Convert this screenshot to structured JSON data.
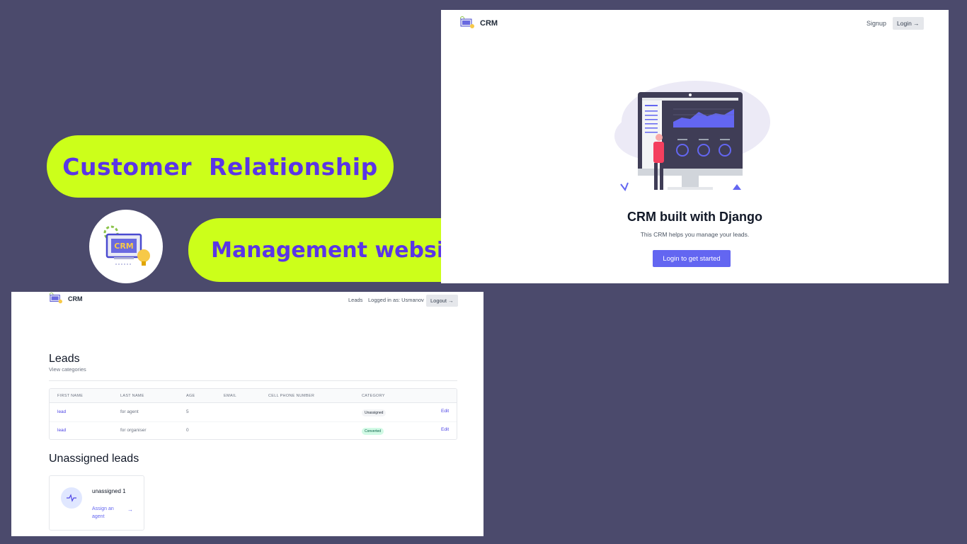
{
  "promo": {
    "line1": "Customer  Relationship",
    "line2": "Management website",
    "logo_text": "CRM"
  },
  "landing": {
    "brand": "CRM",
    "nav_signup": "Signup",
    "nav_login": "Login →",
    "title": "CRM built with Django",
    "subtitle": "This CRM helps you manage your leads.",
    "cta": "Login to get started"
  },
  "dashboard": {
    "brand": "CRM",
    "nav_leads": "Leads",
    "nav_logged_in": "Logged in as: Usmanov",
    "nav_logout": "Logout →",
    "heading": "Leads",
    "view_categories": "View categories",
    "table": {
      "headers": [
        "FIRST NAME",
        "LAST NAME",
        "AGE",
        "EMAIL",
        "CELL PHONE NUMBER",
        "CATEGORY"
      ],
      "rows": [
        {
          "first_name": "lead",
          "last_name": "for agent",
          "age": "5",
          "category": "Unassigned",
          "action": "Edit"
        },
        {
          "first_name": "lead",
          "last_name": "for organiser",
          "age": "0",
          "category": "Converted",
          "action": "Edit"
        }
      ]
    },
    "unassigned_heading": "Unassigned leads",
    "unassigned_card": {
      "title": "unassigned 1",
      "link": "Assign an agent",
      "arrow": "→"
    }
  },
  "colors": {
    "background": "#4b4a6c",
    "pill": "#ccff1a",
    "pill_text": "#5a35e6",
    "accent": "#6366f1"
  }
}
